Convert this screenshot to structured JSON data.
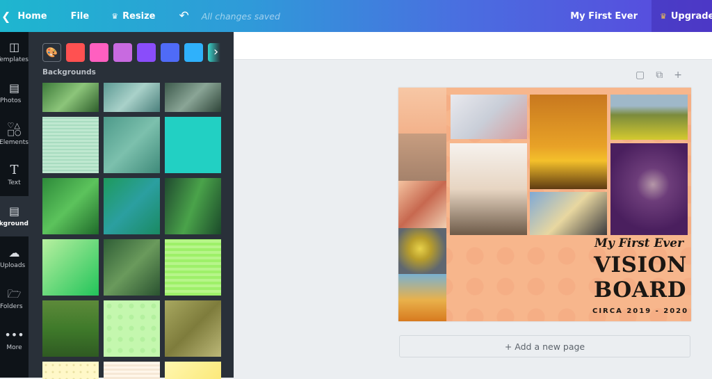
{
  "topbar": {
    "home_label": "Home",
    "file_label": "File",
    "resize_label": "Resize",
    "save_status": "All changes saved",
    "design_title": "My First Ever",
    "upgrade_label": "Upgrade",
    "icons": {
      "back": "chevron-left-icon",
      "crown": "crown-icon",
      "undo": "undo-icon"
    }
  },
  "sidenav": {
    "items": [
      {
        "label": "Templates",
        "icon": "templates-icon",
        "active": false
      },
      {
        "label": "Photos",
        "icon": "photos-icon",
        "active": false
      },
      {
        "label": "Elements",
        "icon": "elements-icon",
        "active": false
      },
      {
        "label": "Text",
        "icon": "text-icon",
        "active": false
      },
      {
        "label": "Background",
        "icon": "background-icon",
        "active": true
      },
      {
        "label": "Uploads",
        "icon": "upload-cloud-icon",
        "active": false
      },
      {
        "label": "Folders",
        "icon": "folder-icon",
        "active": false
      },
      {
        "label": "More",
        "icon": "more-dots-icon",
        "active": false
      }
    ]
  },
  "panel": {
    "swatch_colors": [
      "#ff5151",
      "#ff5fc0",
      "#c86ae0",
      "#8a4dfa",
      "#4f6bf7",
      "#2fb1fb",
      "#37d3c9"
    ],
    "section_title": "Backgrounds",
    "tiles": [
      "green leaves",
      "teal water texture",
      "grey-green ferns",
      "mint gingham",
      "green water",
      "turquoise solid",
      "bright green leaves",
      "teal jellyfish",
      "green aurora",
      "green gradient",
      "fern leaves",
      "lime stripes",
      "green tea hills",
      "light green dots",
      "dry grass",
      "yellow dots",
      "cream stripes",
      "yellow gradient"
    ]
  },
  "canvas": {
    "page_tools": {
      "notes": "note-icon",
      "duplicate": "duplicate-page-icon",
      "add": "add-page-icon"
    },
    "design": {
      "line1": "My First Ever",
      "line2": "VISION",
      "line3": "BOARD",
      "line4": "CIRCA 2019 - 2020",
      "photos": [
        "cocktail",
        "typewriter",
        "tools desk",
        "yellow flowers",
        "tree sunset",
        "home pillows",
        "mother and child beach",
        "heart hands sunset",
        "paint brushes",
        "woman in field",
        "crystals purple"
      ]
    },
    "add_page_label": "+ Add a new page"
  }
}
